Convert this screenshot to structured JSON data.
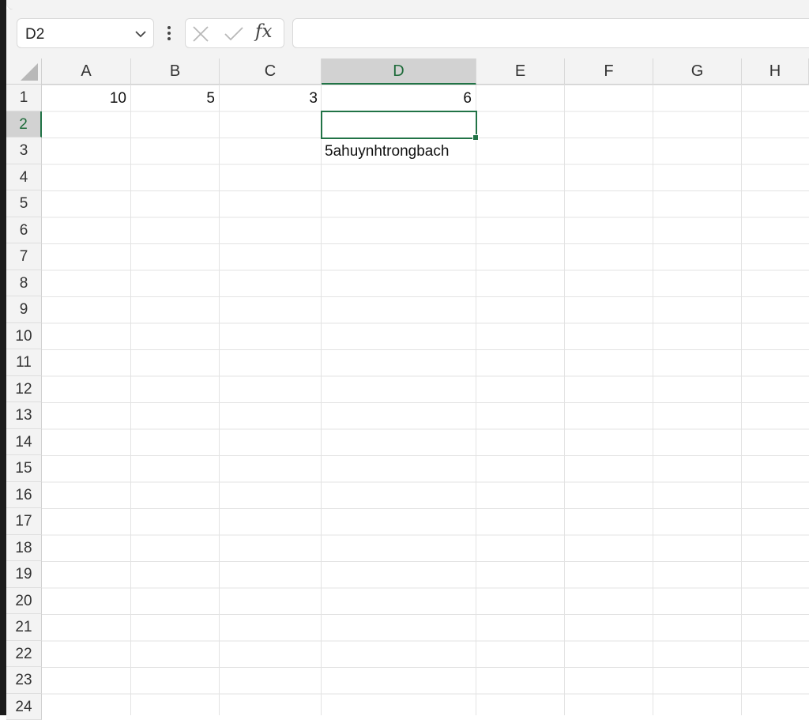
{
  "name_box": {
    "value": "D2"
  },
  "formula_bar": {
    "insert_function_label": "fx",
    "value": ""
  },
  "columns": [
    "A",
    "B",
    "C",
    "D",
    "E",
    "F",
    "G",
    "H"
  ],
  "rows": [
    "1",
    "2",
    "3",
    "4",
    "5",
    "6",
    "7",
    "8",
    "9",
    "10",
    "11",
    "12",
    "13",
    "14",
    "15",
    "16",
    "17",
    "18",
    "19",
    "20",
    "21",
    "22",
    "23",
    "24"
  ],
  "active_column": "D",
  "active_row": "2",
  "cells": {
    "A1": "10",
    "B1": "5",
    "C1": "3",
    "D1": "6",
    "D2": "",
    "D3": "5ahuynhtrongbach"
  },
  "colors": {
    "accent": "#217346",
    "header_bg": "#f3f3f3",
    "active_header_bg": "#d2d2d2",
    "gridline": "#e3e3e3"
  },
  "icons": {
    "name_box_dropdown": "chevron-down-icon",
    "more_options": "vertical-ellipsis-icon",
    "cancel": "x-icon",
    "enter": "checkmark-icon",
    "insert_function": "fx-icon",
    "select_all": "triangle-icon"
  }
}
